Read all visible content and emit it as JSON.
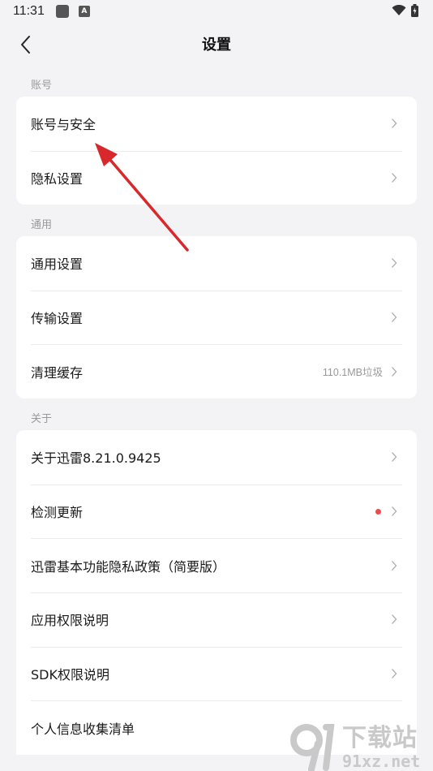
{
  "status_bar": {
    "time": "11:31",
    "a_badge": "A"
  },
  "header": {
    "title": "设置"
  },
  "sections": [
    {
      "label": "账号",
      "rows": [
        {
          "label": "账号与安全"
        },
        {
          "label": "隐私设置"
        }
      ]
    },
    {
      "label": "通用",
      "rows": [
        {
          "label": "通用设置"
        },
        {
          "label": "传输设置"
        },
        {
          "label": "清理缓存",
          "value": "110.1MB垃圾"
        }
      ]
    },
    {
      "label": "关于",
      "rows": [
        {
          "label": "关于迅雷8.21.0.9425"
        },
        {
          "label": "检测更新",
          "badge": "red-dot"
        },
        {
          "label": "迅雷基本功能隐私政策（简要版）"
        },
        {
          "label": "应用权限说明"
        },
        {
          "label": "SDK权限说明"
        },
        {
          "label": "个人信息收集清单"
        }
      ]
    }
  ],
  "watermark": {
    "brand": "下载站",
    "domain": "91xz.net"
  },
  "colors": {
    "annotation_arrow": "#d8282b",
    "badge_dot": "#f04a4a"
  }
}
